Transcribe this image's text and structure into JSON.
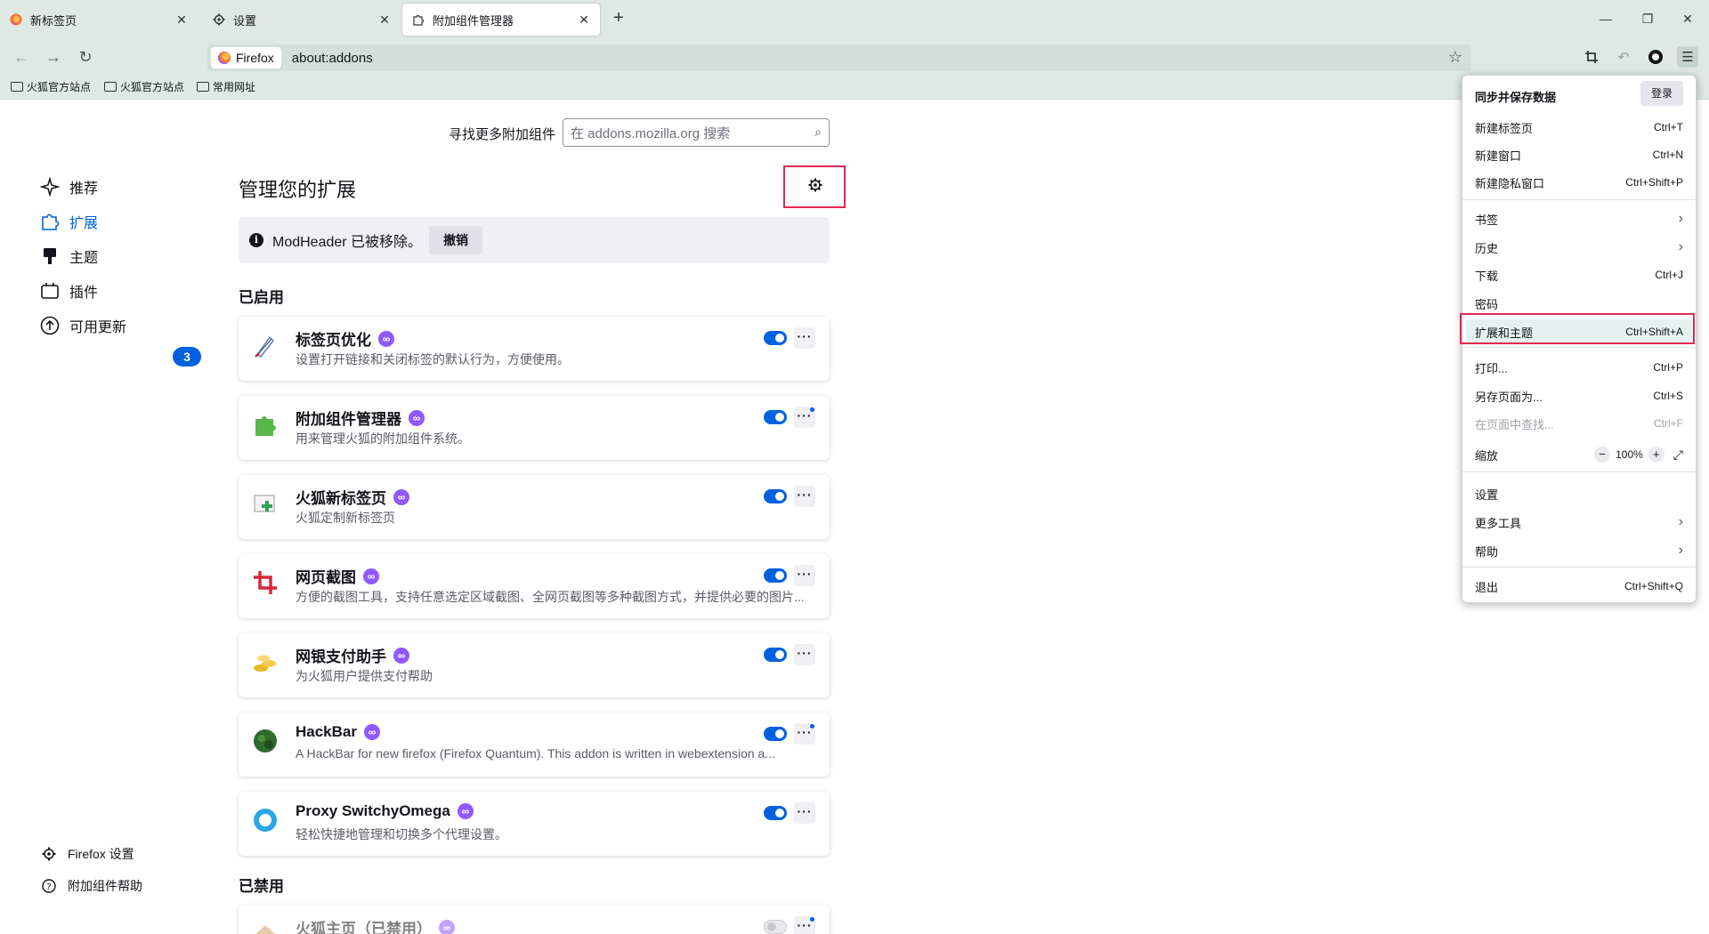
{
  "tabs": [
    {
      "label": "新标签页",
      "icon": "firefox-icon"
    },
    {
      "label": "设置",
      "icon": "gear-icon"
    },
    {
      "label": "附加组件管理器",
      "icon": "puzzle-icon"
    }
  ],
  "urlbar": {
    "identity": "Firefox",
    "url": "about:addons"
  },
  "bookmarks": [
    "火狐官方站点",
    "火狐官方站点",
    "常用网址"
  ],
  "search": {
    "label": "寻找更多附加组件",
    "placeholder": "在 addons.mozilla.org 搜索"
  },
  "sidebar": {
    "items": [
      {
        "label": "推荐",
        "icon": "sparkle-icon"
      },
      {
        "label": "扩展",
        "icon": "puzzle-icon"
      },
      {
        "label": "主题",
        "icon": "brush-icon"
      },
      {
        "label": "插件",
        "icon": "plugin-icon"
      },
      {
        "label": "可用更新",
        "icon": "update-arrow-icon"
      }
    ],
    "update_count": "3",
    "footer": [
      {
        "label": "Firefox 设置",
        "icon": "gear-icon"
      },
      {
        "label": "附加组件帮助",
        "icon": "help-icon"
      }
    ]
  },
  "main": {
    "heading": "管理您的扩展",
    "notice": {
      "text": "ModHeader 已被移除。",
      "undo": "撤销"
    },
    "enabled_title": "已启用",
    "disabled_title": "已禁用",
    "extensions": [
      {
        "name": "标签页优化",
        "desc": "设置打开链接和关闭标签的默认行为，方便使用。",
        "icon": "feather-pen-icon",
        "enabled": true,
        "dot": false
      },
      {
        "name": "附加组件管理器",
        "desc": "用来管理火狐的附加组件系统。",
        "icon": "green-puzzle-icon",
        "enabled": true,
        "dot": true
      },
      {
        "name": "火狐新标签页",
        "desc": "火狐定制新标签页",
        "icon": "new-tab-icon",
        "enabled": true,
        "dot": false
      },
      {
        "name": "网页截图",
        "desc": "方便的截图工具，支持任意选定区域截图、全网页截图等多种截图方式，并提供必要的图片...",
        "icon": "crop-icon",
        "enabled": true,
        "dot": false
      },
      {
        "name": "网银支付助手",
        "desc": "为火狐用户提供支付帮助",
        "icon": "coins-icon",
        "enabled": true,
        "dot": false
      },
      {
        "name": "HackBar",
        "desc": "A HackBar for new firefox (Firefox Quantum). This addon is written in webextension a...",
        "icon": "hackbar-icon",
        "enabled": true,
        "dot": true
      },
      {
        "name": "Proxy SwitchyOmega",
        "desc": "轻松快捷地管理和切换多个代理设置。",
        "icon": "switchyomega-icon",
        "enabled": true,
        "dot": false
      }
    ],
    "disabled_extensions": [
      {
        "name": "火狐主页（已禁用）",
        "icon": "home-icon",
        "enabled": false,
        "dot": true
      }
    ]
  },
  "appmenu": {
    "sync_title": "同步并保存数据",
    "login": "登录",
    "items": [
      {
        "label": "新建标签页",
        "shortcut": "Ctrl+T"
      },
      {
        "label": "新建窗口",
        "shortcut": "Ctrl+N"
      },
      {
        "label": "新建隐私窗口",
        "shortcut": "Ctrl+Shift+P"
      },
      {
        "label": "书签",
        "shortcut": ""
      },
      {
        "label": "历史",
        "shortcut": ""
      },
      {
        "label": "下载",
        "shortcut": "Ctrl+J"
      },
      {
        "label": "密码",
        "shortcut": ""
      },
      {
        "label": "扩展和主题",
        "shortcut": "Ctrl+Shift+A"
      },
      {
        "label": "打印...",
        "shortcut": "Ctrl+P"
      },
      {
        "label": "另存页面为...",
        "shortcut": "Ctrl+S"
      },
      {
        "label": "在页面中查找...",
        "shortcut": "Ctrl+F"
      },
      {
        "label": "缩放",
        "shortcut": ""
      },
      {
        "label": "设置",
        "shortcut": ""
      },
      {
        "label": "更多工具",
        "shortcut": ""
      },
      {
        "label": "帮助",
        "shortcut": ""
      },
      {
        "label": "退出",
        "shortcut": "Ctrl+Shift+Q"
      }
    ],
    "zoom_level": "100%"
  },
  "colors": {
    "accent": "#0061e0",
    "highlight": "#e22850",
    "recommended": "#9059ff"
  }
}
